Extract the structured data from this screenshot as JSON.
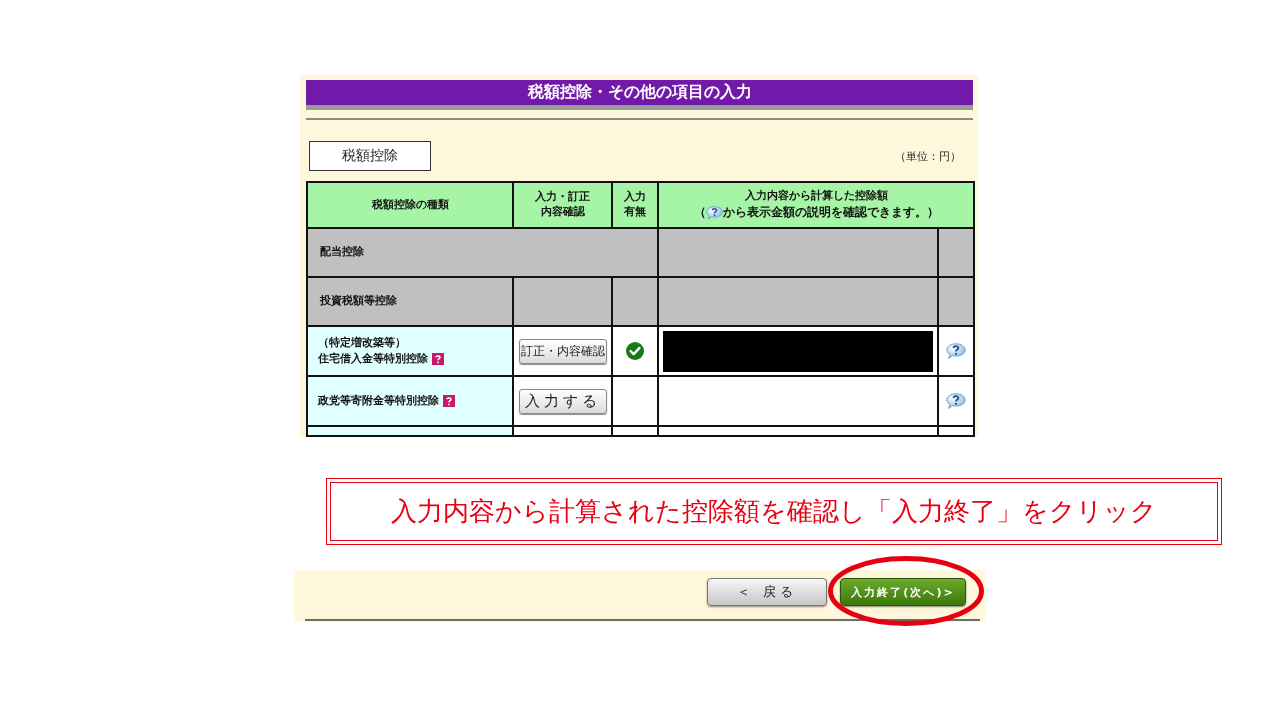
{
  "form_screen": {
    "title": "税額控除・その他の項目の入力",
    "section_tab": "税額控除",
    "unit_note": "（単位：円）",
    "table": {
      "columns": [
        {
          "lines": [
            "税額控除の種類"
          ]
        },
        {
          "lines": [
            "入力・訂正",
            "内容確認"
          ]
        },
        {
          "lines": [
            "入力",
            "有無"
          ]
        },
        {
          "lines": [
            "入力内容から計算した控除額"
          ],
          "note_prefix": "（",
          "note": "から表示金額の説明を確認できます。）"
        }
      ],
      "rows": [
        {
          "kind": "group",
          "lines": [
            "配当控除"
          ],
          "merged": true
        },
        {
          "kind": "group",
          "lines": [
            "投資税額等控除"
          ],
          "merged": false
        },
        {
          "kind": "item",
          "lines": [
            "（特定増改築等）",
            "住宅借入金等特別控除"
          ],
          "button": "訂正・内容確認",
          "entered": true,
          "amount_redacted": true
        },
        {
          "kind": "item",
          "lines": [
            "政党等寄附金等特別控除"
          ],
          "button": "入力する",
          "entered": false,
          "amount_redacted": false
        }
      ]
    }
  },
  "callout": {
    "text": "入力内容から計算された控除額を確認し「入力終了」をクリック"
  },
  "footer_screen": {
    "buttons": [
      {
        "kind": "back",
        "label": "＜ 戻る",
        "highlighted": false
      },
      {
        "kind": "next",
        "label": "入力終了(次へ)>",
        "highlighted": true
      }
    ]
  }
}
